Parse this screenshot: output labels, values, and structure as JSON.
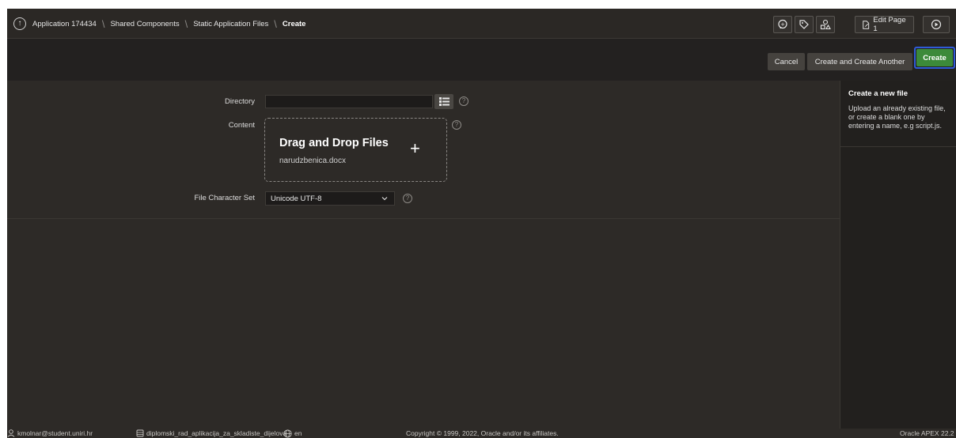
{
  "breadcrumb": {
    "items": [
      "Application 174434",
      "Shared Components",
      "Static Application Files"
    ],
    "current": "Create"
  },
  "toolbar": {
    "edit_page_label": "Edit Page 1"
  },
  "buttons": {
    "cancel": "Cancel",
    "create_another": "Create and Create Another",
    "create": "Create"
  },
  "form": {
    "directory_label": "Directory",
    "directory_value": "",
    "content_label": "Content",
    "dropzone_title": "Drag and Drop Files",
    "dropzone_file": "narudzbenica.docx",
    "charset_label": "File Character Set",
    "charset_value": "Unicode UTF-8"
  },
  "sidebar": {
    "title": "Create a new file",
    "text": "Upload an already existing file, or create a blank one by entering a name, e.g script.js."
  },
  "footer": {
    "user": "kmolnar@student.uniri.hr",
    "workspace": "diplomski_rad_aplikacija_za_skladiste_dijelova",
    "language": "en",
    "copyright": "Copyright © 1999, 2022, Oracle and/or its affiliates.",
    "version": "Oracle APEX 22.2"
  },
  "colors": {
    "primary_button": "#3c8a3a",
    "focus_outline": "#2f5bd8",
    "background": "#2d2a27"
  }
}
